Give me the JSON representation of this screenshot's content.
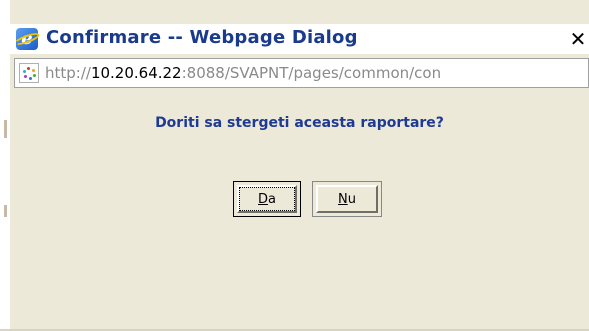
{
  "window": {
    "title": "Confirmare -- Webpage Dialog",
    "close_glyph": "✕",
    "app_icon": "ie-icon",
    "app_icon_glyph": "e"
  },
  "address_bar": {
    "scheme": "http://",
    "host": "10.20.64.22",
    "path": ":8088/SVAPNT/pages/common/con"
  },
  "dialog": {
    "message": "Doriti sa stergeti aceasta raportare?",
    "buttons": [
      {
        "access_key": "D",
        "rest": "a"
      },
      {
        "access_key": "N",
        "rest": "u"
      }
    ]
  },
  "colors": {
    "title_text": "#1a3a8c",
    "message_text": "#1f3a93",
    "dialog_bg": "#ece9d8"
  }
}
